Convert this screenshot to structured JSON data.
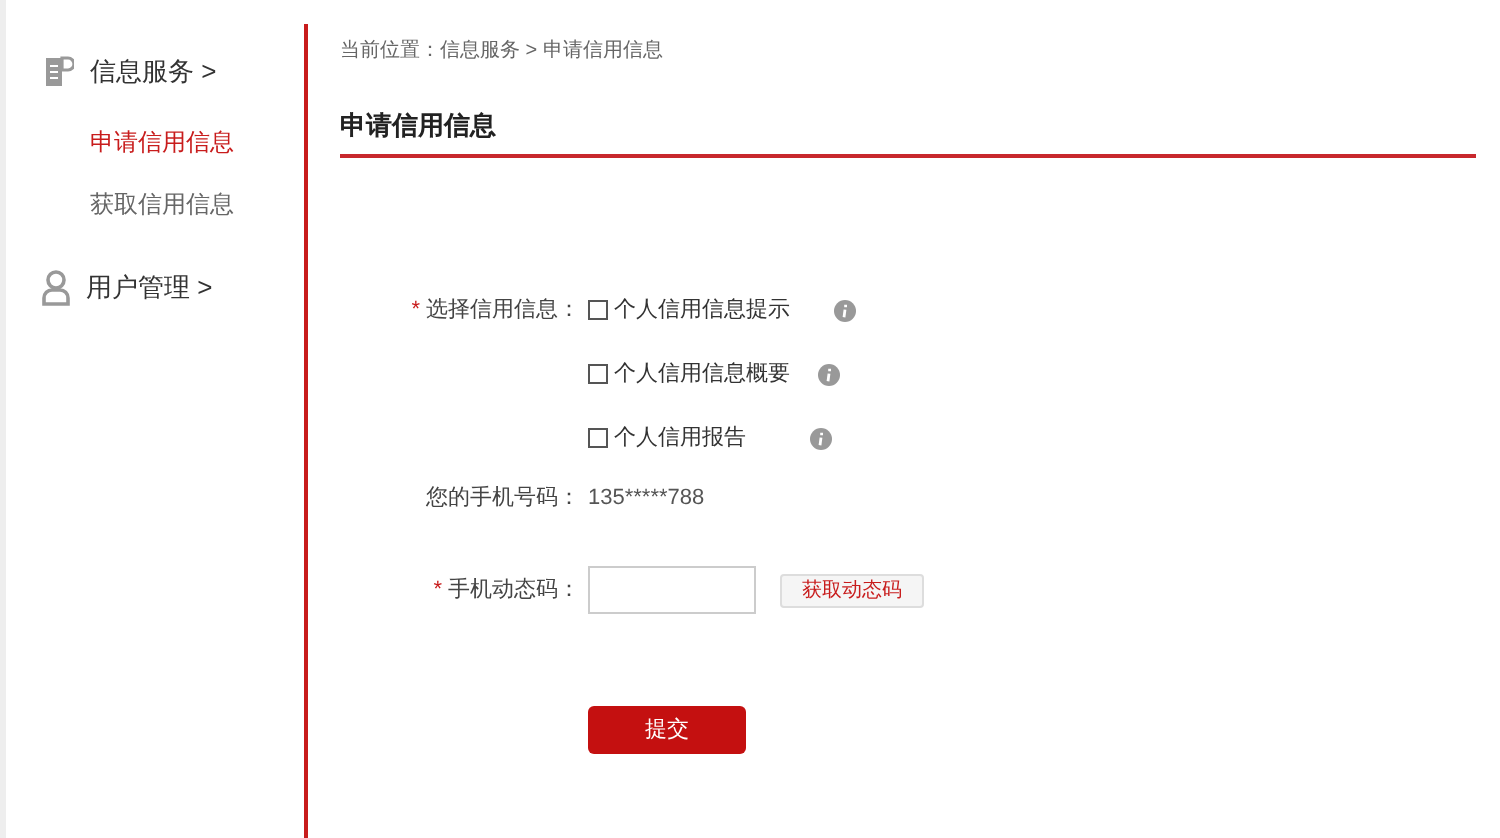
{
  "sidebar": {
    "groups": [
      {
        "kind": "doc",
        "title": "信息服务 >",
        "items": [
          {
            "label": "申请信用信息",
            "selected": true
          },
          {
            "label": "获取信用信息",
            "selected": false
          }
        ]
      },
      {
        "kind": "user",
        "title": "用户管理 >"
      }
    ]
  },
  "breadcrumb": "当前位置：信息服务 > 申请信用信息",
  "page_title": "申请信用信息",
  "form": {
    "credit": {
      "required_mark": "*",
      "label": "选择信用信息：",
      "options": [
        {
          "label": "个人信用信息提示",
          "checked": false
        },
        {
          "label": "个人信用信息概要",
          "checked": false
        },
        {
          "label": "个人信用报告",
          "checked": false
        }
      ]
    },
    "phone": {
      "label": "您的手机号码：",
      "value": "135*****788"
    },
    "code": {
      "required_mark": "*",
      "label": "手机动态码：",
      "button": "获取动态码"
    },
    "submit": "提交"
  }
}
